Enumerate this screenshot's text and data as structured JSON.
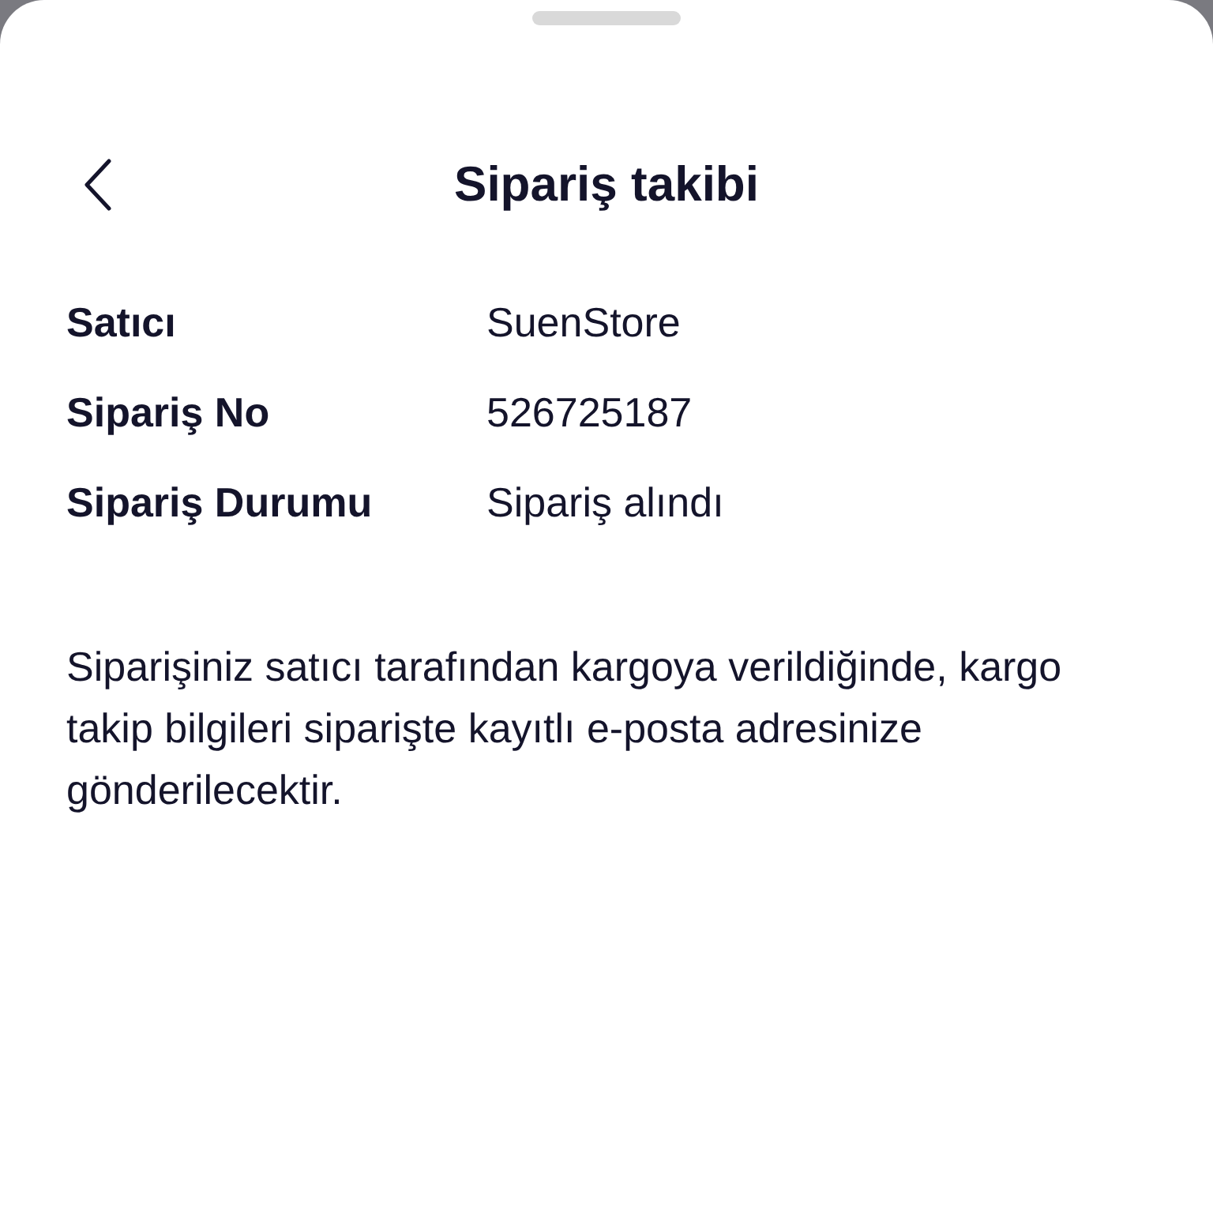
{
  "header": {
    "title": "Sipariş takibi"
  },
  "details": [
    {
      "label": "Satıcı",
      "value": "SuenStore"
    },
    {
      "label": "Sipariş No",
      "value": "526725187"
    },
    {
      "label": "Sipariş Durumu",
      "value": "Sipariş alındı"
    }
  ],
  "message": "Siparişiniz satıcı tarafından kargoya verildiğinde, kargo takip bilgileri siparişte kayıtlı e-posta adresinize gönderilecektir."
}
